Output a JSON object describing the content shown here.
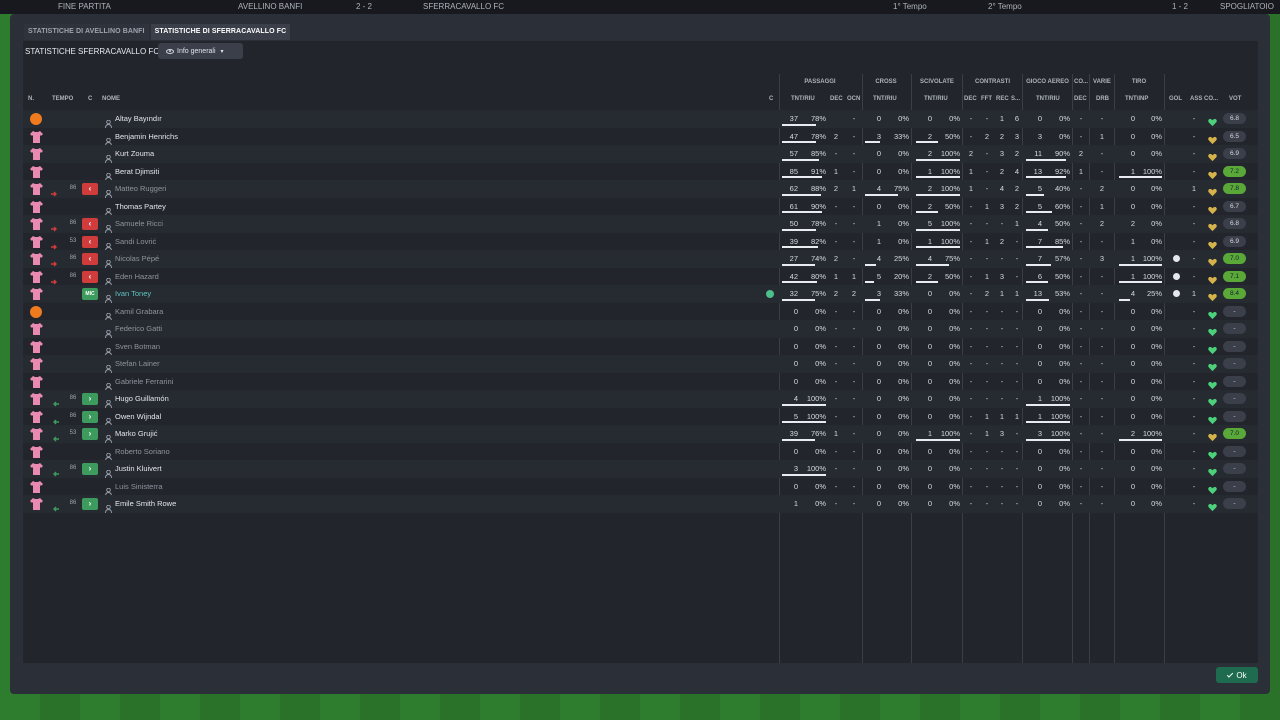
{
  "topbar": {
    "left_label": "FINE PARTITA",
    "home_team": "AVELLINO BANFI",
    "score": "2 - 2",
    "away_team": "SFERRACAVALLO FC",
    "period1": "1° Tempo",
    "period2": "2° Tempo",
    "score2": "1 - 2",
    "right_label": "SPOGLIATOIO"
  },
  "tabs": [
    {
      "label": "STATISTICHE DI AVELLINO BANFI"
    },
    {
      "label": "STATISTICHE DI SFERRACAVALLO FC"
    }
  ],
  "panel": {
    "title": "STATISTICHE SFERRACAVALLO FC",
    "dropdown_label": "Info generali"
  },
  "headers": {
    "groups": {
      "passaggi": "PASSAGGI",
      "cross": "CROSS",
      "scivolate": "SCIVOLATE",
      "contrasti": "CONTRASTI",
      "gioco_aereo": "GIOCO AEREO",
      "co": "CO...",
      "varie": "VARIE",
      "tiro": "TIRO"
    },
    "cols": {
      "n": "N.",
      "tempo": "TEMPO",
      "c": "C",
      "nome": "NOME",
      "c2": "C",
      "pass_tnt": "TNT/RIU",
      "dec": "DEC",
      "ocn": "OCN",
      "cross_tnt": "TNT/RIU",
      "sciv_tnt": "TNT/RIU",
      "con_dec": "DEC",
      "con_fft": "FFT",
      "con_rec": "REC",
      "con_s": "S...",
      "aereo_tnt": "TNT/RIU",
      "co_dec": "DEC",
      "drb": "DRB",
      "tiro_tnt": "TNT\\INP",
      "gol": "GOL",
      "ass": "ASS",
      "co2": "CO...",
      "vot": "VOT"
    }
  },
  "players": [
    {
      "shirt": "gk",
      "sub": "",
      "subtime": "",
      "pos": "",
      "name": "Altay Bayındır",
      "muted": false,
      "c": false,
      "pass": [
        "37",
        "78%",
        78
      ],
      "dec": "",
      "ocn": "-",
      "cross": [
        "0",
        "0%",
        0
      ],
      "sciv": [
        "0",
        "0%",
        0
      ],
      "con": [
        "-",
        "-",
        "1",
        "6"
      ],
      "aereo": [
        "0",
        "0%",
        0
      ],
      "codec": "-",
      "drb": "-",
      "tiro": [
        "0",
        "0%",
        0
      ],
      "gol": "",
      "ass": "-",
      "vot": "6.8",
      "good": false
    },
    {
      "shirt": "pink",
      "sub": "",
      "subtime": "",
      "pos": "",
      "name": "Benjamin Henrichs",
      "muted": false,
      "c": false,
      "pass": [
        "47",
        "78%",
        78
      ],
      "dec": "2",
      "ocn": "-",
      "cross": [
        "3",
        "33%",
        33
      ],
      "sciv": [
        "2",
        "50%",
        50
      ],
      "con": [
        "-",
        "2",
        "2",
        "3"
      ],
      "aereo": [
        "3",
        "0%",
        0
      ],
      "codec": "-",
      "drb": "1",
      "tiro": [
        "0",
        "0%",
        0
      ],
      "gol": "",
      "ass": "-",
      "vot": "6.5",
      "good": false
    },
    {
      "shirt": "pink",
      "sub": "",
      "subtime": "",
      "pos": "",
      "name": "Kurt Zouma",
      "muted": false,
      "c": false,
      "pass": [
        "57",
        "85%",
        85
      ],
      "dec": "-",
      "ocn": "-",
      "cross": [
        "0",
        "0%",
        0
      ],
      "sciv": [
        "2",
        "100%",
        100
      ],
      "con": [
        "2",
        "-",
        "3",
        "2"
      ],
      "aereo": [
        "11",
        "90%",
        90
      ],
      "codec": "2",
      "drb": "-",
      "tiro": [
        "0",
        "0%",
        0
      ],
      "gol": "",
      "ass": "-",
      "vot": "6.9",
      "good": false
    },
    {
      "shirt": "pink",
      "sub": "",
      "subtime": "",
      "pos": "",
      "name": "Berat Djimsiti",
      "muted": false,
      "c": false,
      "pass": [
        "85",
        "91%",
        91
      ],
      "dec": "1",
      "ocn": "-",
      "cross": [
        "0",
        "0%",
        0
      ],
      "sciv": [
        "1",
        "100%",
        100
      ],
      "con": [
        "1",
        "-",
        "2",
        "4"
      ],
      "aereo": [
        "13",
        "92%",
        92
      ],
      "codec": "1",
      "drb": "-",
      "tiro": [
        "1",
        "100%",
        100
      ],
      "gol": "",
      "ass": "-",
      "vot": "7.2",
      "good": true
    },
    {
      "shirt": "pink",
      "sub": "out",
      "subtime": "86",
      "pos": "out",
      "name": "Matteo Ruggeri",
      "muted": true,
      "c": false,
      "pass": [
        "62",
        "88%",
        88
      ],
      "dec": "2",
      "ocn": "1",
      "cross": [
        "4",
        "75%",
        75
      ],
      "sciv": [
        "2",
        "100%",
        100
      ],
      "con": [
        "1",
        "-",
        "4",
        "2"
      ],
      "aereo": [
        "5",
        "40%",
        40
      ],
      "codec": "-",
      "drb": "2",
      "tiro": [
        "0",
        "0%",
        0
      ],
      "gol": "",
      "ass": "1",
      "vot": "7.8",
      "good": true
    },
    {
      "shirt": "pink",
      "sub": "",
      "subtime": "",
      "pos": "",
      "name": "Thomas Partey",
      "muted": false,
      "c": false,
      "pass": [
        "61",
        "90%",
        90
      ],
      "dec": "-",
      "ocn": "-",
      "cross": [
        "0",
        "0%",
        0
      ],
      "sciv": [
        "2",
        "50%",
        50
      ],
      "con": [
        "-",
        "1",
        "3",
        "2"
      ],
      "aereo": [
        "5",
        "60%",
        60
      ],
      "codec": "-",
      "drb": "1",
      "tiro": [
        "0",
        "0%",
        0
      ],
      "gol": "",
      "ass": "-",
      "vot": "6.7",
      "good": false
    },
    {
      "shirt": "pink",
      "sub": "out",
      "subtime": "86",
      "pos": "out",
      "name": "Samuele Ricci",
      "muted": true,
      "c": false,
      "pass": [
        "50",
        "78%",
        78
      ],
      "dec": "-",
      "ocn": "-",
      "cross": [
        "1",
        "0%",
        0
      ],
      "sciv": [
        "5",
        "100%",
        100
      ],
      "con": [
        "-",
        "-",
        "-",
        "1"
      ],
      "aereo": [
        "4",
        "50%",
        50
      ],
      "codec": "-",
      "drb": "2",
      "tiro": [
        "2",
        "0%",
        0
      ],
      "gol": "",
      "ass": "-",
      "vot": "6.8",
      "good": false
    },
    {
      "shirt": "pink",
      "sub": "out",
      "subtime": "53",
      "pos": "out",
      "name": "Sandi Lovrić",
      "muted": true,
      "c": false,
      "pass": [
        "39",
        "82%",
        82
      ],
      "dec": "-",
      "ocn": "-",
      "cross": [
        "1",
        "0%",
        0
      ],
      "sciv": [
        "1",
        "100%",
        100
      ],
      "con": [
        "-",
        "1",
        "2",
        "-"
      ],
      "aereo": [
        "7",
        "85%",
        85
      ],
      "codec": "-",
      "drb": "-",
      "tiro": [
        "1",
        "0%",
        0
      ],
      "gol": "",
      "ass": "-",
      "vot": "6.9",
      "good": false
    },
    {
      "shirt": "pink",
      "sub": "out",
      "subtime": "86",
      "pos": "out",
      "name": "Nicolas Pépé",
      "muted": true,
      "c": false,
      "pass": [
        "27",
        "74%",
        74
      ],
      "dec": "2",
      "ocn": "-",
      "cross": [
        "4",
        "25%",
        25
      ],
      "sciv": [
        "4",
        "75%",
        75
      ],
      "con": [
        "-",
        "-",
        "-",
        "-"
      ],
      "aereo": [
        "7",
        "57%",
        57
      ],
      "codec": "-",
      "drb": "3",
      "tiro": [
        "1",
        "100%",
        100
      ],
      "gol": "ball",
      "ass": "-",
      "vot": "7.0",
      "good": true
    },
    {
      "shirt": "pink",
      "sub": "out",
      "subtime": "86",
      "pos": "out",
      "name": "Eden Hazard",
      "muted": true,
      "c": false,
      "pass": [
        "42",
        "80%",
        80
      ],
      "dec": "1",
      "ocn": "1",
      "cross": [
        "5",
        "20%",
        20
      ],
      "sciv": [
        "2",
        "50%",
        50
      ],
      "con": [
        "-",
        "1",
        "3",
        "-"
      ],
      "aereo": [
        "6",
        "50%",
        50
      ],
      "codec": "-",
      "drb": "-",
      "tiro": [
        "1",
        "100%",
        100
      ],
      "gol": "ball",
      "ass": "-",
      "vot": "7.1",
      "good": true
    },
    {
      "shirt": "pink",
      "sub": "",
      "subtime": "",
      "pos": "mic",
      "name": "Ivan Toney",
      "muted": false,
      "c": true,
      "selected": true,
      "pass": [
        "32",
        "75%",
        75
      ],
      "dec": "2",
      "ocn": "2",
      "cross": [
        "3",
        "33%",
        33
      ],
      "sciv": [
        "0",
        "0%",
        0
      ],
      "con": [
        "-",
        "2",
        "1",
        "1"
      ],
      "aereo": [
        "13",
        "53%",
        53
      ],
      "codec": "-",
      "drb": "-",
      "tiro": [
        "4",
        "25%",
        25
      ],
      "gol": "ball",
      "ass": "1",
      "vot": "8.4",
      "good": true
    },
    {
      "shirt": "gk",
      "sub": "",
      "subtime": "",
      "pos": "",
      "name": "Kamil Grabara",
      "muted": true,
      "c": false,
      "pass": [
        "0",
        "0%",
        0
      ],
      "dec": "-",
      "ocn": "-",
      "cross": [
        "0",
        "0%",
        0
      ],
      "sciv": [
        "0",
        "0%",
        0
      ],
      "con": [
        "-",
        "-",
        "-",
        "-"
      ],
      "aereo": [
        "0",
        "0%",
        0
      ],
      "codec": "-",
      "drb": "-",
      "tiro": [
        "0",
        "0%",
        0
      ],
      "gol": "",
      "ass": "-",
      "vot": "-",
      "good": false
    },
    {
      "shirt": "pink",
      "sub": "",
      "subtime": "",
      "pos": "",
      "name": "Federico Gatti",
      "muted": true,
      "c": false,
      "pass": [
        "0",
        "0%",
        0
      ],
      "dec": "-",
      "ocn": "-",
      "cross": [
        "0",
        "0%",
        0
      ],
      "sciv": [
        "0",
        "0%",
        0
      ],
      "con": [
        "-",
        "-",
        "-",
        "-"
      ],
      "aereo": [
        "0",
        "0%",
        0
      ],
      "codec": "-",
      "drb": "-",
      "tiro": [
        "0",
        "0%",
        0
      ],
      "gol": "",
      "ass": "-",
      "vot": "-",
      "good": false
    },
    {
      "shirt": "pink",
      "sub": "",
      "subtime": "",
      "pos": "",
      "name": "Sven Botman",
      "muted": true,
      "c": false,
      "pass": [
        "0",
        "0%",
        0
      ],
      "dec": "-",
      "ocn": "-",
      "cross": [
        "0",
        "0%",
        0
      ],
      "sciv": [
        "0",
        "0%",
        0
      ],
      "con": [
        "-",
        "-",
        "-",
        "-"
      ],
      "aereo": [
        "0",
        "0%",
        0
      ],
      "codec": "-",
      "drb": "-",
      "tiro": [
        "0",
        "0%",
        0
      ],
      "gol": "",
      "ass": "-",
      "vot": "-",
      "good": false
    },
    {
      "shirt": "pink",
      "sub": "",
      "subtime": "",
      "pos": "",
      "name": "Stefan Lainer",
      "muted": true,
      "c": false,
      "pass": [
        "0",
        "0%",
        0
      ],
      "dec": "-",
      "ocn": "-",
      "cross": [
        "0",
        "0%",
        0
      ],
      "sciv": [
        "0",
        "0%",
        0
      ],
      "con": [
        "-",
        "-",
        "-",
        "-"
      ],
      "aereo": [
        "0",
        "0%",
        0
      ],
      "codec": "-",
      "drb": "-",
      "tiro": [
        "0",
        "0%",
        0
      ],
      "gol": "",
      "ass": "-",
      "vot": "-",
      "good": false
    },
    {
      "shirt": "pink",
      "sub": "",
      "subtime": "",
      "pos": "",
      "name": "Gabriele Ferrarini",
      "muted": true,
      "c": false,
      "pass": [
        "0",
        "0%",
        0
      ],
      "dec": "-",
      "ocn": "-",
      "cross": [
        "0",
        "0%",
        0
      ],
      "sciv": [
        "0",
        "0%",
        0
      ],
      "con": [
        "-",
        "-",
        "-",
        "-"
      ],
      "aereo": [
        "0",
        "0%",
        0
      ],
      "codec": "-",
      "drb": "-",
      "tiro": [
        "0",
        "0%",
        0
      ],
      "gol": "",
      "ass": "-",
      "vot": "-",
      "good": false
    },
    {
      "shirt": "pink",
      "sub": "in",
      "subtime": "86",
      "pos": "in",
      "name": "Hugo Guillamón",
      "muted": false,
      "c": false,
      "pass": [
        "4",
        "100%",
        100
      ],
      "dec": "-",
      "ocn": "-",
      "cross": [
        "0",
        "0%",
        0
      ],
      "sciv": [
        "0",
        "0%",
        0
      ],
      "con": [
        "-",
        "-",
        "-",
        "-"
      ],
      "aereo": [
        "1",
        "100%",
        100
      ],
      "codec": "-",
      "drb": "-",
      "tiro": [
        "0",
        "0%",
        0
      ],
      "gol": "",
      "ass": "-",
      "vot": "-",
      "good": false
    },
    {
      "shirt": "pink",
      "sub": "in",
      "subtime": "86",
      "pos": "in",
      "name": "Owen Wijndal",
      "muted": false,
      "c": false,
      "pass": [
        "5",
        "100%",
        100
      ],
      "dec": "-",
      "ocn": "-",
      "cross": [
        "0",
        "0%",
        0
      ],
      "sciv": [
        "0",
        "0%",
        0
      ],
      "con": [
        "-",
        "1",
        "1",
        "1"
      ],
      "aereo": [
        "1",
        "100%",
        100
      ],
      "codec": "-",
      "drb": "-",
      "tiro": [
        "0",
        "0%",
        0
      ],
      "gol": "",
      "ass": "-",
      "vot": "-",
      "good": false
    },
    {
      "shirt": "pink",
      "sub": "in",
      "subtime": "53",
      "pos": "in",
      "name": "Marko Grujić",
      "muted": false,
      "c": false,
      "pass": [
        "39",
        "76%",
        76
      ],
      "dec": "1",
      "ocn": "-",
      "cross": [
        "0",
        "0%",
        0
      ],
      "sciv": [
        "1",
        "100%",
        100
      ],
      "con": [
        "-",
        "1",
        "3",
        "-"
      ],
      "aereo": [
        "3",
        "100%",
        100
      ],
      "codec": "-",
      "drb": "-",
      "tiro": [
        "2",
        "100%",
        100
      ],
      "gol": "",
      "ass": "-",
      "vot": "7.0",
      "good": true
    },
    {
      "shirt": "pink",
      "sub": "",
      "subtime": "",
      "pos": "",
      "name": "Roberto Soriano",
      "muted": true,
      "c": false,
      "pass": [
        "0",
        "0%",
        0
      ],
      "dec": "-",
      "ocn": "-",
      "cross": [
        "0",
        "0%",
        0
      ],
      "sciv": [
        "0",
        "0%",
        0
      ],
      "con": [
        "-",
        "-",
        "-",
        "-"
      ],
      "aereo": [
        "0",
        "0%",
        0
      ],
      "codec": "-",
      "drb": "-",
      "tiro": [
        "0",
        "0%",
        0
      ],
      "gol": "",
      "ass": "-",
      "vot": "-",
      "good": false
    },
    {
      "shirt": "pink",
      "sub": "in",
      "subtime": "86",
      "pos": "in",
      "name": "Justin Kluivert",
      "muted": false,
      "c": false,
      "pass": [
        "3",
        "100%",
        100
      ],
      "dec": "-",
      "ocn": "-",
      "cross": [
        "0",
        "0%",
        0
      ],
      "sciv": [
        "0",
        "0%",
        0
      ],
      "con": [
        "-",
        "-",
        "-",
        "-"
      ],
      "aereo": [
        "0",
        "0%",
        0
      ],
      "codec": "-",
      "drb": "-",
      "tiro": [
        "0",
        "0%",
        0
      ],
      "gol": "",
      "ass": "-",
      "vot": "-",
      "good": false
    },
    {
      "shirt": "pink",
      "sub": "",
      "subtime": "",
      "pos": "",
      "name": "Luis Sinisterra",
      "muted": true,
      "c": false,
      "pass": [
        "0",
        "0%",
        0
      ],
      "dec": "-",
      "ocn": "-",
      "cross": [
        "0",
        "0%",
        0
      ],
      "sciv": [
        "0",
        "0%",
        0
      ],
      "con": [
        "-",
        "-",
        "-",
        "-"
      ],
      "aereo": [
        "0",
        "0%",
        0
      ],
      "codec": "-",
      "drb": "-",
      "tiro": [
        "0",
        "0%",
        0
      ],
      "gol": "",
      "ass": "-",
      "vot": "-",
      "good": false
    },
    {
      "shirt": "pink",
      "sub": "in",
      "subtime": "86",
      "pos": "in",
      "name": "Emile Smith Rowe",
      "muted": false,
      "c": false,
      "pass": [
        "1",
        "0%",
        0
      ],
      "dec": "-",
      "ocn": "-",
      "cross": [
        "0",
        "0%",
        0
      ],
      "sciv": [
        "0",
        "0%",
        0
      ],
      "con": [
        "-",
        "-",
        "-",
        "-"
      ],
      "aereo": [
        "0",
        "0%",
        0
      ],
      "codec": "-",
      "drb": "-",
      "tiro": [
        "0",
        "0%",
        0
      ],
      "gol": "",
      "ass": "-",
      "vot": "-",
      "good": false
    }
  ],
  "footer": {
    "ok_label": "Ok"
  },
  "colors": {
    "accent": "#1f6b4f",
    "shirt": "#e98bb0",
    "gk": "#f07b1f",
    "out": "#d03c3c",
    "in": "#3d9b5e",
    "good_vote": "#5aa838"
  }
}
